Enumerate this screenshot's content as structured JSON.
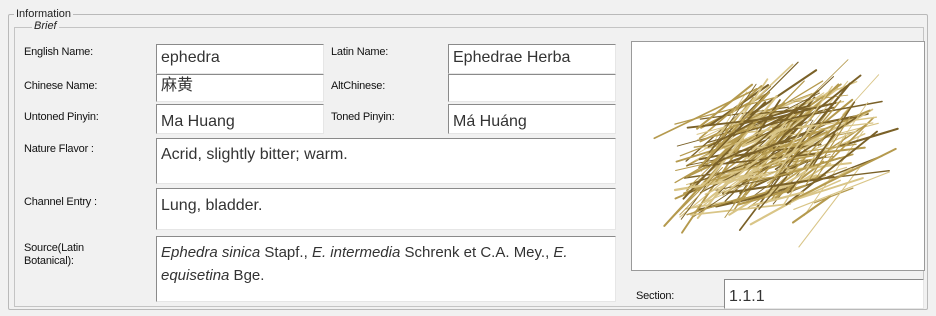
{
  "group": {
    "title": "Information",
    "subtitle": "Brief"
  },
  "fields": {
    "english_name": {
      "label": "English Name:",
      "value": "ephedra"
    },
    "latin_name": {
      "label": "Latin Name:",
      "value": "Ephedrae Herba"
    },
    "chinese_name": {
      "label": "Chinese Name:",
      "value": "麻黄"
    },
    "alt_chinese": {
      "label": "AltChinese:",
      "value": ""
    },
    "untoned_pinyin": {
      "label": "Untoned Pinyin:",
      "value": "Ma Huang"
    },
    "toned_pinyin": {
      "label": "Toned Pinyin:",
      "value": "Má Huáng"
    },
    "nature_flavor": {
      "label": "Nature Flavor :",
      "value": "Acrid, slightly bitter; warm."
    },
    "channel_entry": {
      "label": "Channel Entry :",
      "value": "Lung, bladder."
    },
    "source": {
      "label_line1": "Source(Latin",
      "label_line2": "Botanical):",
      "parts": [
        {
          "text": "Ephedra sinica",
          "italic": true
        },
        {
          "text": " Stapf., ",
          "italic": false
        },
        {
          "text": "E. intermedia",
          "italic": true
        },
        {
          "text": " Schrenk et C.A. Mey., ",
          "italic": false
        },
        {
          "text": "E. equisetina",
          "italic": true
        },
        {
          "text": " Bge.",
          "italic": false
        }
      ]
    },
    "section": {
      "label": "Section:",
      "value": "1.1.1"
    }
  },
  "image": {
    "subject": "ephedra-herb-photo",
    "stem_color": "#b59a4e",
    "stem_dark": "#7a6128",
    "stem_light": "#d9c587"
  }
}
